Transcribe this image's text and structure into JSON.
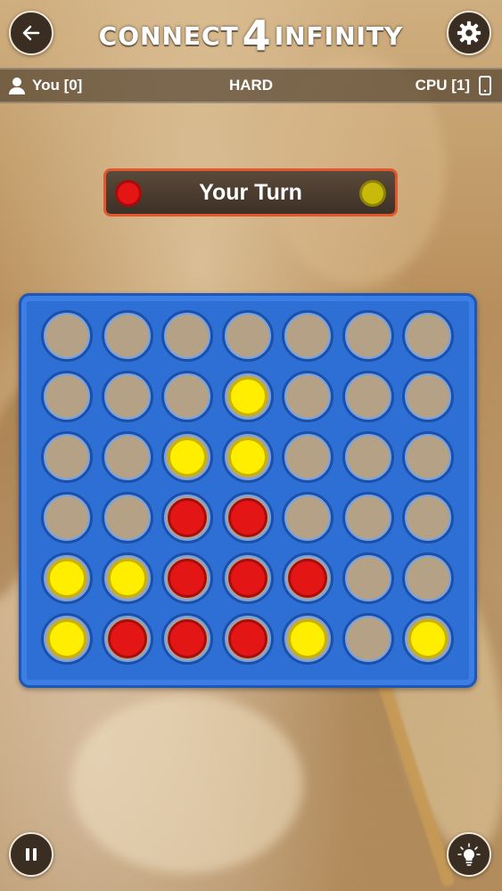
{
  "header": {
    "logo_left": "CONNECT",
    "logo_number": "4",
    "logo_right": "INFINITY"
  },
  "scorebar": {
    "player_label": "You [0]",
    "difficulty": "HARD",
    "cpu_label": "CPU [1]"
  },
  "turn_banner": {
    "text": "Your Turn",
    "player_color": "#e41515",
    "cpu_color": "#c8b90b"
  },
  "board": {
    "columns": 7,
    "rows": 6,
    "grid": [
      [
        "",
        "",
        "",
        "",
        "",
        "",
        ""
      ],
      [
        "",
        "",
        "",
        "Y",
        "",
        "",
        ""
      ],
      [
        "",
        "",
        "Y",
        "Y",
        "",
        "",
        ""
      ],
      [
        "",
        "",
        "R",
        "R",
        "",
        "",
        ""
      ],
      [
        "Y",
        "Y",
        "R",
        "R",
        "R",
        "",
        ""
      ],
      [
        "Y",
        "R",
        "R",
        "R",
        "Y",
        "",
        "Y"
      ]
    ],
    "colors": {
      "R": "#e41515",
      "Y": "#ffee00",
      "board": "#2e6fd6"
    }
  },
  "icons": {
    "back": "back-arrow-icon",
    "settings": "gear-icon",
    "player": "person-icon",
    "cpu": "phone-icon",
    "pause": "pause-icon",
    "hint": "lightbulb-icon"
  }
}
